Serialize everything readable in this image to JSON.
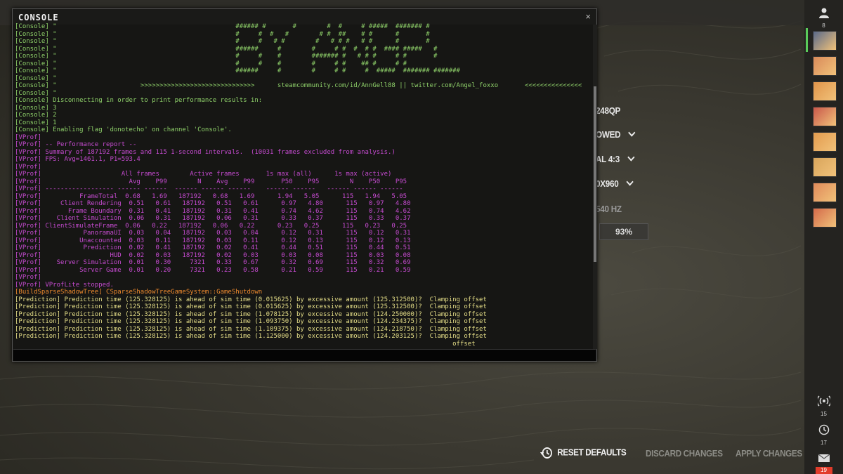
{
  "console": {
    "title": "CONSOLE",
    "close_glyph": "×",
    "lines": [
      {
        "c": "c-green",
        "t": "[Console] \"                                               ###### #       #        #  #     # #####  ####### #"
      },
      {
        "c": "c-green",
        "t": "[Console] \"                                               #     #  #   #        # #  ##    # #      #       #"
      },
      {
        "c": "c-green",
        "t": "[Console] \"                                               #     #   # #        #   # # #   # #      #       #"
      },
      {
        "c": "c-green",
        "t": "[Console] \"                                               ######     #        #     # #  #  # #  #### #####   #"
      },
      {
        "c": "c-green",
        "t": "[Console] \"                                               #     #    #        ####### #   # # #     # #       #"
      },
      {
        "c": "c-green",
        "t": "[Console] \"                                               #     #    #        #     # #    ## #     # #"
      },
      {
        "c": "c-green",
        "t": "[Console] \"                                               ######     #        #     # #     #  #####  ####### #######"
      },
      {
        "c": "c-green",
        "t": "[Console] \""
      },
      {
        "c": "c-green",
        "t": "[Console] \"                      >>>>>>>>>>>>>>>>>>>>>>>>>>>>>>      steamcommunity.com/id/AnnGell88 || twitter.com/Angel_foxxo       <<<<<<<<<<<<<<<"
      },
      {
        "c": "c-green",
        "t": "[Console] \""
      },
      {
        "c": "c-green",
        "t": "[Console] Disconnecting in order to print performance results in:"
      },
      {
        "c": "c-green",
        "t": "[Console] 3"
      },
      {
        "c": "c-green",
        "t": "[Console] 2"
      },
      {
        "c": "c-green",
        "t": "[Console] 1"
      },
      {
        "c": "c-green",
        "t": "[Console] Enabling flag 'donotecho' on channel 'Console'."
      },
      {
        "c": "c-mag",
        "t": "[VProf]"
      },
      {
        "c": "c-mag",
        "t": "[VProf] -- Performance report --"
      },
      {
        "c": "c-mag",
        "t": "[VProf] Summary of 187192 frames and 115 1-second intervals.  (10031 frames excluded from analysis.)"
      },
      {
        "c": "c-mag",
        "t": "[VProf] FPS: Avg=1461.1, P1=593.4"
      },
      {
        "c": "c-mag",
        "t": "[VProf]"
      },
      {
        "c": "c-mag",
        "t": "[VProf]                     All frames        Active frames       1s max (all)      1s max (active)"
      },
      {
        "c": "c-mag",
        "t": "[VProf]                       Avg    P99        N    Avg    P99       P50    P95        N    P50    P95"
      },
      {
        "c": "c-mag",
        "t": "[VProf] ------------------ ------ ------  ------ ------ ------    ------ ------   ------ ------ ------"
      },
      {
        "c": "c-mag",
        "t": "[VProf]          FrameTotal  0.68   1.69   187192   0.68   1.69      1.94   5.05      115   1.94   5.05"
      },
      {
        "c": "c-mag",
        "t": "[VProf]     Client Rendering  0.51   0.61   187192   0.51   0.61      0.97   4.80      115   0.97   4.80"
      },
      {
        "c": "c-mag",
        "t": "[VProf]       Frame Boundary  0.31   0.41   187192   0.31   0.41      0.74   4.62      115   0.74   4.62"
      },
      {
        "c": "c-mag",
        "t": "[VProf]    Client Simulation  0.06   0.31   187192   0.06   0.31      0.33   0.37      115   0.33   0.37"
      },
      {
        "c": "c-mag",
        "t": "[VProf] ClientSimulateFrame  0.06   0.22   187192   0.06   0.22      0.23   0.25      115   0.23   0.25"
      },
      {
        "c": "c-mag",
        "t": "[VProf]           PanoramaUI  0.03   0.04   187192   0.03   0.04      0.12   0.31      115   0.12   0.31"
      },
      {
        "c": "c-mag",
        "t": "[VProf]          Unaccounted  0.03   0.11   187192   0.03   0.11      0.12   0.13      115   0.12   0.13"
      },
      {
        "c": "c-mag",
        "t": "[VProf]           Prediction  0.02   0.41   187192   0.02   0.41      0.44   0.51      115   0.44   0.51"
      },
      {
        "c": "c-mag",
        "t": "[VProf]                  HUD  0.02   0.03   187192   0.02   0.03      0.03   0.08      115   0.03   0.08"
      },
      {
        "c": "c-mag",
        "t": "[VProf]    Server Simulation  0.01   0.30     7321   0.33   0.67      0.32   0.69      115   0.32   0.69"
      },
      {
        "c": "c-mag",
        "t": "[VProf]          Server Game  0.01   0.20     7321   0.23   0.58      0.21   0.59      115   0.21   0.59"
      },
      {
        "c": "c-mag",
        "t": "[VProf]"
      },
      {
        "c": "c-mag",
        "t": "[VProf] VProfLite stopped."
      },
      {
        "c": "c-orange",
        "t": "[BuildSparseShadowTree] CSparseShadowTreeGameSystem::GameShutdown"
      },
      {
        "c": "c-yellow",
        "t": "[Prediction] Prediction time (125.328125) is ahead of sim time (0.015625) by excessive amount (125.312500)?  Clamping offset"
      },
      {
        "c": "c-yellow",
        "t": "[Prediction] Prediction time (125.328125) is ahead of sim time (0.015625) by excessive amount (125.312500)?  Clamping offset"
      },
      {
        "c": "c-yellow",
        "t": "[Prediction] Prediction time (125.328125) is ahead of sim time (1.078125) by excessive amount (124.250000)?  Clamping offset"
      },
      {
        "c": "c-yellow",
        "t": "[Prediction] Prediction time (125.328125) is ahead of sim time (1.093750) by excessive amount (124.234375)?  Clamping offset"
      },
      {
        "c": "c-yellow",
        "t": "[Prediction] Prediction time (125.328125) is ahead of sim time (1.109375) by excessive amount (124.218750)?  Clamping offset"
      },
      {
        "c": "c-yellow",
        "t": "[Prediction] Prediction time (125.328125) is ahead of sim time (1.125000) by excessive amount (124.203125)?  Clamping offset"
      },
      {
        "c": "c-yellow",
        "t": "                                                                                                                   offset"
      }
    ]
  },
  "settings": {
    "rows": [
      {
        "label": "248QP",
        "dropdown": false
      },
      {
        "label": "OWED",
        "dropdown": true
      },
      {
        "label": "AL 4:3",
        "dropdown": true
      },
      {
        "label": "0X960",
        "dropdown": true
      },
      {
        "label": "540 HZ",
        "dropdown": false
      }
    ],
    "percent_value": "93%"
  },
  "sidebar": {
    "friends_count": "8",
    "icon_colors": [
      "#5a6a8a",
      "#d98a5a",
      "#e0944a",
      "#c9574a",
      "#e39b4e",
      "#d9a55c",
      "#e08a5a",
      "#d46a4a"
    ],
    "signal_count": "15",
    "history_count": "17",
    "mail_count": "19"
  },
  "footer": {
    "reset_label": "RESET DEFAULTS",
    "discard_label": "DISCARD CHANGES",
    "apply_label": "APPLY CHANGES"
  }
}
